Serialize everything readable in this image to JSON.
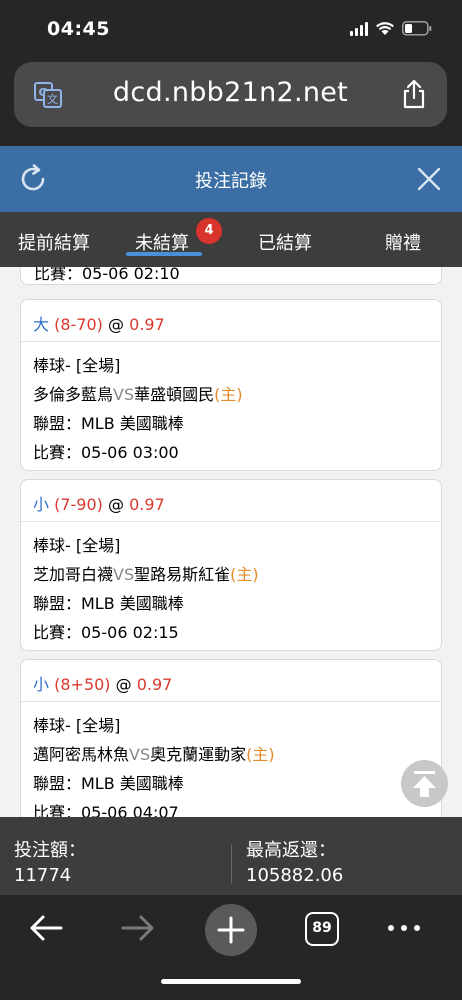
{
  "status": {
    "time": "04:45"
  },
  "browser": {
    "url": "dcd.nbb21n2.net"
  },
  "header": {
    "title": "投注記錄"
  },
  "tabs": [
    {
      "label": "提前結算"
    },
    {
      "label": "未結算",
      "active": true,
      "badge": "4"
    },
    {
      "label": "已結算"
    },
    {
      "label": "贈禮"
    }
  ],
  "partial_card": {
    "match_line": "比賽：05-06 02:10"
  },
  "bets": [
    {
      "type": "大",
      "line": "(8-70)",
      "at": "@",
      "odds": "0.97",
      "sport": "棒球- [全場]",
      "away": "多倫多藍鳥",
      "vs": "VS",
      "home": "華盛頓國民",
      "home_tag": "(主)",
      "league": "聯盟：MLB 美國職棒",
      "match": "比賽：05-06 03:00"
    },
    {
      "type": "小",
      "line": "(7-90)",
      "at": "@",
      "odds": "0.97",
      "sport": "棒球- [全場]",
      "away": "芝加哥白襪",
      "vs": "VS",
      "home": "聖路易斯紅雀",
      "home_tag": "(主)",
      "league": "聯盟：MLB 美國職棒",
      "match": "比賽：05-06 02:15"
    },
    {
      "type": "小",
      "line": "(8+50)",
      "at": "@",
      "odds": "0.97",
      "sport": "棒球- [全場]",
      "away": "邁阿密馬林魚",
      "vs": "VS",
      "home": "奧克蘭運動家",
      "home_tag": "(主)",
      "league": "聯盟：MLB 美國職棒",
      "match": "比賽：05-06 04:07"
    }
  ],
  "summary": {
    "stake_label": "投注額：",
    "stake_value": "11774",
    "max_return_label": "最高返還：",
    "max_return_value": "105882.06"
  },
  "toolbar": {
    "tab_count": "89"
  },
  "colors": {
    "header_bg": "#3a6ea5",
    "bet_type": "#2f6fc7",
    "odds": "#d93a2f",
    "home_tag": "#e58b27",
    "badge": "#d9332d"
  }
}
